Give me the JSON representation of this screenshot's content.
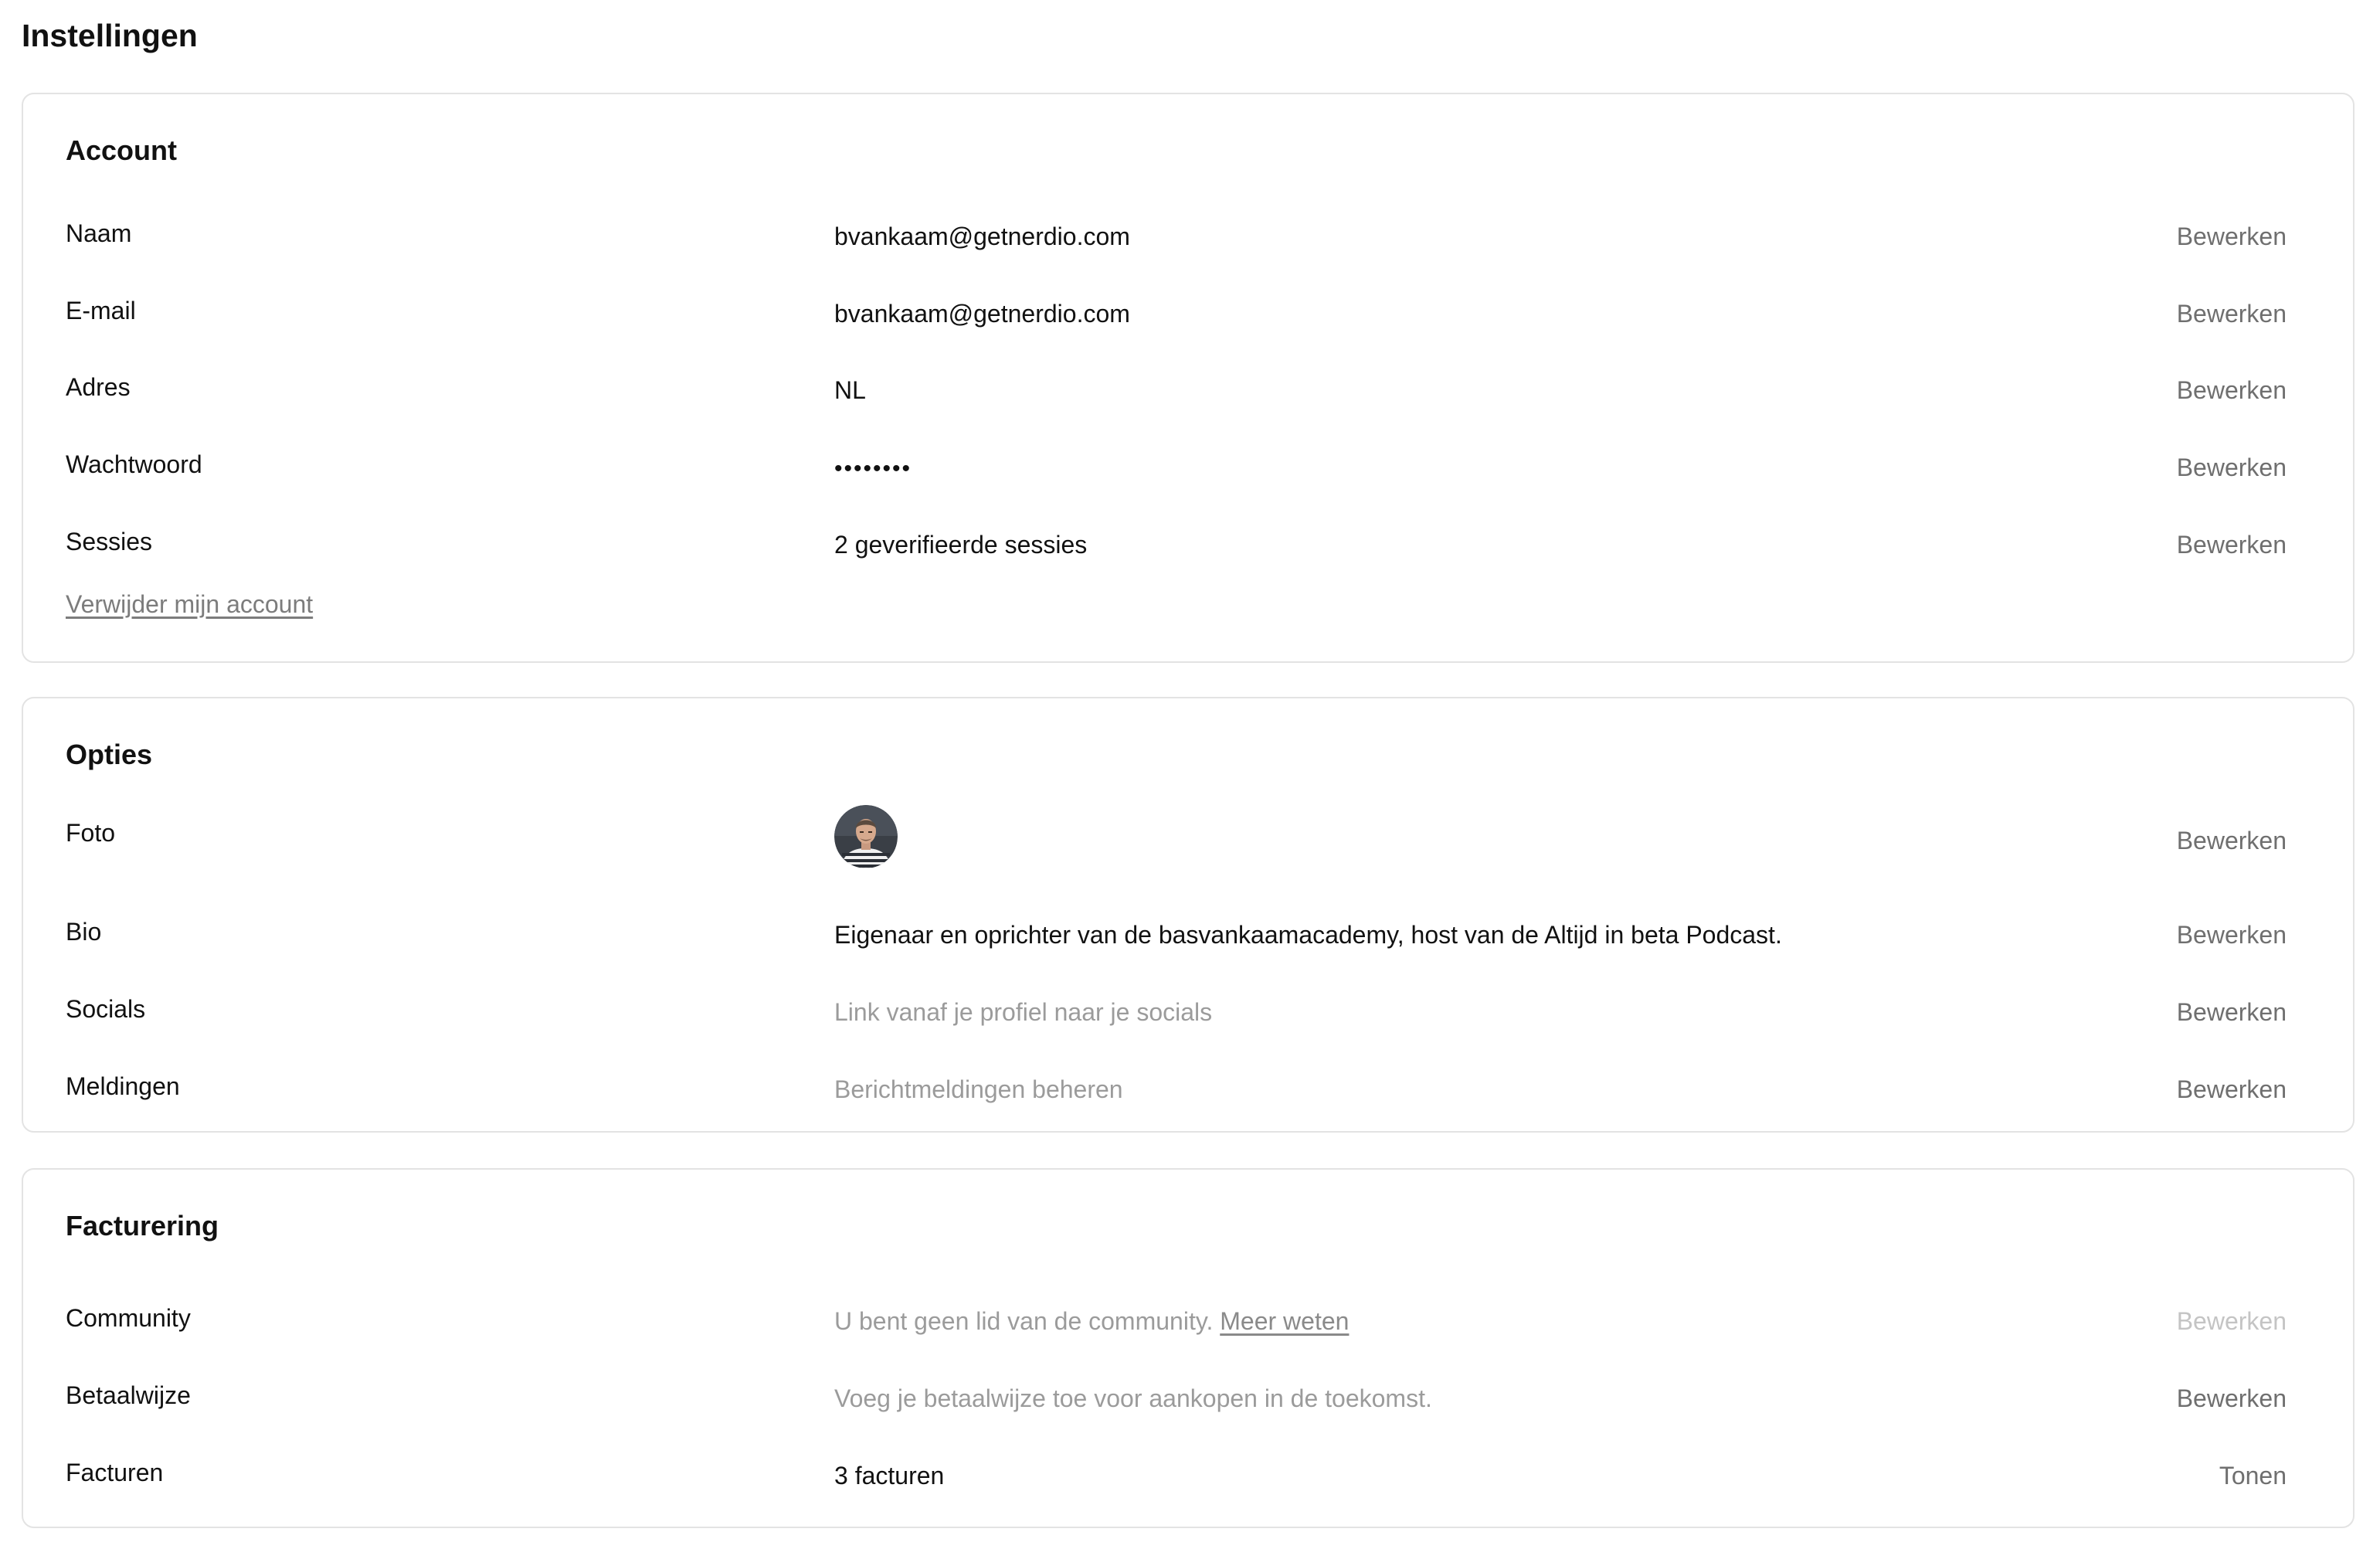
{
  "page": {
    "title": "Instellingen"
  },
  "account": {
    "title": "Account",
    "rows": [
      {
        "label": "Naam",
        "value": "bvankaam@getnerdio.com",
        "action": "Bewerken"
      },
      {
        "label": "E-mail",
        "value": "bvankaam@getnerdio.com",
        "action": "Bewerken"
      },
      {
        "label": "Adres",
        "value": "NL",
        "action": "Bewerken"
      },
      {
        "label": "Wachtwoord",
        "value": "••••••••",
        "action": "Bewerken"
      },
      {
        "label": "Sessies",
        "value": "2 geverifieerde sessies",
        "action": "Bewerken"
      }
    ],
    "delete_link": "Verwijder mijn account"
  },
  "opties": {
    "title": "Opties",
    "rows": [
      {
        "label": "Foto",
        "value": "",
        "action": "Bewerken"
      },
      {
        "label": "Bio",
        "value": "Eigenaar en oprichter van de basvankaamacademy, host van de Altijd in beta Podcast.",
        "action": "Bewerken"
      },
      {
        "label": "Socials",
        "value": "Link vanaf je profiel naar je socials",
        "action": "Bewerken"
      },
      {
        "label": "Meldingen",
        "value": "Berichtmeldingen beheren",
        "action": "Bewerken"
      }
    ]
  },
  "facturering": {
    "title": "Facturering",
    "rows": [
      {
        "label": "Community",
        "value": "U bent geen lid van de community.",
        "link": "Meer weten",
        "action": "Bewerken"
      },
      {
        "label": "Betaalwijze",
        "value": "Voeg je betaalwijze toe voor aankopen in de toekomst.",
        "action": "Bewerken"
      },
      {
        "label": "Facturen",
        "value": "3 facturen",
        "action": "Tonen"
      }
    ]
  },
  "colors": {
    "text": "#111111",
    "muted": "#9b9b9b",
    "action": "#6f6f6f",
    "action_disabled": "#c4c4c4",
    "border": "#e3e3e3"
  },
  "icons": {
    "avatar": "profile-photo"
  }
}
